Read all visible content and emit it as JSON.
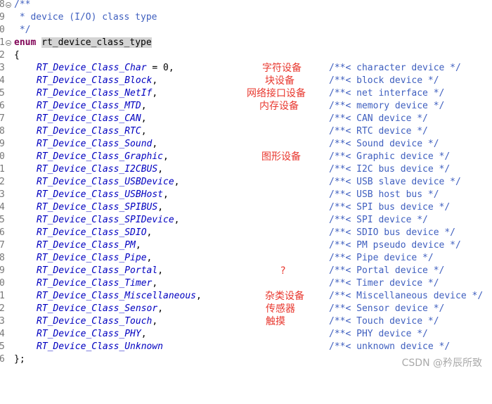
{
  "header_lines": [
    {
      "ln": "8",
      "fold": true,
      "text": "/**"
    },
    {
      "ln": "9",
      "fold": false,
      "text": " * device (I/O) class type"
    },
    {
      "ln": "0",
      "fold": false,
      "text": " */"
    }
  ],
  "enum_line": {
    "ln": "1",
    "keyword": "enum",
    "name": "rt_device_class_type"
  },
  "open_brace": {
    "ln": "2",
    "text": "{"
  },
  "items": [
    {
      "ln": "3",
      "code": "RT_Device_Class_Char",
      "suffix": " = 0,",
      "comment": "/**< character device */",
      "note": "字符设备"
    },
    {
      "ln": "4",
      "code": "RT_Device_Class_Block",
      "suffix": ",",
      "comment": "/**< block device */",
      "note": "块设备"
    },
    {
      "ln": "5",
      "code": "RT_Device_Class_NetIf",
      "suffix": ",",
      "comment": "/**< net interface */",
      "note": "网络接口设备"
    },
    {
      "ln": "6",
      "code": "RT_Device_Class_MTD",
      "suffix": ",",
      "comment": "/**< memory device */",
      "note": "内存设备"
    },
    {
      "ln": "7",
      "code": "RT_Device_Class_CAN",
      "suffix": ",",
      "comment": "/**< CAN device */",
      "note": ""
    },
    {
      "ln": "8",
      "code": "RT_Device_Class_RTC",
      "suffix": ",",
      "comment": "/**< RTC device */",
      "note": ""
    },
    {
      "ln": "9",
      "code": "RT_Device_Class_Sound",
      "suffix": ",",
      "comment": "/**< Sound device */",
      "note": ""
    },
    {
      "ln": "0",
      "code": "RT_Device_Class_Graphic",
      "suffix": ",",
      "comment": "/**< Graphic device */",
      "note": "图形设备"
    },
    {
      "ln": "1",
      "code": "RT_Device_Class_I2CBUS",
      "suffix": ",",
      "comment": "/**< I2C bus device */",
      "note": ""
    },
    {
      "ln": "2",
      "code": "RT_Device_Class_USBDevice",
      "suffix": ",",
      "comment": "/**< USB slave device */",
      "note": ""
    },
    {
      "ln": "3",
      "code": "RT_Device_Class_USBHost",
      "suffix": ",",
      "comment": "/**< USB host bus */",
      "note": ""
    },
    {
      "ln": "4",
      "code": "RT_Device_Class_SPIBUS",
      "suffix": ",",
      "comment": "/**< SPI bus device */",
      "note": ""
    },
    {
      "ln": "5",
      "code": "RT_Device_Class_SPIDevice",
      "suffix": ",",
      "comment": "/**< SPI device */",
      "note": ""
    },
    {
      "ln": "6",
      "code": "RT_Device_Class_SDIO",
      "suffix": ",",
      "comment": "/**< SDIO bus device */",
      "note": ""
    },
    {
      "ln": "7",
      "code": "RT_Device_Class_PM",
      "suffix": ",",
      "comment": "/**< PM pseudo device */",
      "note": ""
    },
    {
      "ln": "8",
      "code": "RT_Device_Class_Pipe",
      "suffix": ",",
      "comment": "/**< Pipe device */",
      "note": ""
    },
    {
      "ln": "9",
      "code": "RT_Device_Class_Portal",
      "suffix": ",",
      "comment": "/**< Portal device */",
      "note": "?"
    },
    {
      "ln": "0",
      "code": "RT_Device_Class_Timer",
      "suffix": ",",
      "comment": "/**< Timer device */",
      "note": ""
    },
    {
      "ln": "1",
      "code": "RT_Device_Class_Miscellaneous",
      "suffix": ",",
      "comment": "/**< Miscellaneous device */",
      "note": "杂类设备"
    },
    {
      "ln": "2",
      "code": "RT_Device_Class_Sensor",
      "suffix": ",",
      "comment": "/**< Sensor device */",
      "note": "传感器"
    },
    {
      "ln": "3",
      "code": "RT_Device_Class_Touch",
      "suffix": ",",
      "comment": "/**< Touch device */",
      "note": "触摸"
    },
    {
      "ln": "4",
      "code": "RT_Device_Class_PHY",
      "suffix": ",",
      "comment": "/**< PHY device */",
      "note": ""
    },
    {
      "ln": "5",
      "code": "RT_Device_Class_Unknown",
      "suffix": "",
      "comment": "/**< unknown device */",
      "note": ""
    }
  ],
  "close_brace": {
    "ln": "6",
    "text": "};"
  },
  "watermark": "CSDN @矜辰所致",
  "colors": {
    "keyword": "#7f0055",
    "constant": "#0000c0",
    "comment": "#3f5fbf",
    "annotation": "#e8382f"
  }
}
